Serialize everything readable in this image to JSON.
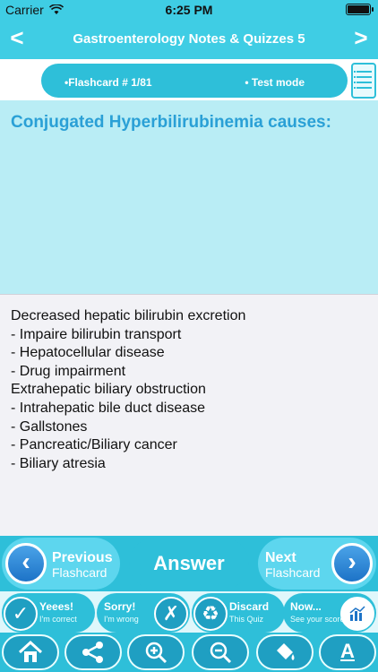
{
  "status_bar": {
    "carrier": "Carrier",
    "time": "6:25 PM",
    "wifi_icon": "wifi-icon",
    "battery_icon": "battery-icon"
  },
  "nav": {
    "back_icon": "chevron-left-icon",
    "title": "Gastroenterology Notes & Quizzes 5",
    "forward_icon": "chevron-right-icon"
  },
  "sub_header": {
    "flashcard_counter": "•Flashcard #  1/81",
    "mode": "• Test mode",
    "menu_icon": "list-icon"
  },
  "question": {
    "text": "Conjugated Hyperbilirubinemia causes:"
  },
  "answer": {
    "lines": [
      "Decreased hepatic bilirubin excretion",
      "- Impaire bilirubin transport",
      "- Hepatocellular disease",
      "- Drug impairment",
      "Extrahepatic biliary obstruction",
      "- Intrahepatic bile duct disease",
      "- Gallstones",
      "- Pancreatic/Biliary cancer",
      "- Biliary atresia"
    ]
  },
  "controls": {
    "previous": {
      "label1": "Previous",
      "label2": "Flashcard",
      "icon": "arrow-left-icon"
    },
    "answer": {
      "label": "Answer"
    },
    "next": {
      "label1": "Next",
      "label2": "Flashcard",
      "icon": "arrow-right-icon"
    }
  },
  "quiz_buttons": [
    {
      "title": "Yeees!",
      "subtitle": "I'm correct",
      "icon": "check-icon"
    },
    {
      "title": "Sorry!",
      "subtitle": "I'm wrong",
      "icon": "x-icon"
    },
    {
      "title": "Discard",
      "subtitle": "This Quiz",
      "icon": "recycle-icon"
    },
    {
      "title": "Now...",
      "subtitle": "See your score",
      "icon": "chart-icon"
    }
  ],
  "toolbar_icons": [
    "home-icon",
    "share-icon",
    "zoom-in-icon",
    "zoom-out-icon",
    "paint-bucket-icon",
    "font-icon"
  ],
  "colors": {
    "accent": "#2ebfd9",
    "header": "#3fcde4",
    "question_bg": "#b9edf5",
    "answer_bg": "#f2f2f6",
    "question_text": "#2aa0d6"
  }
}
